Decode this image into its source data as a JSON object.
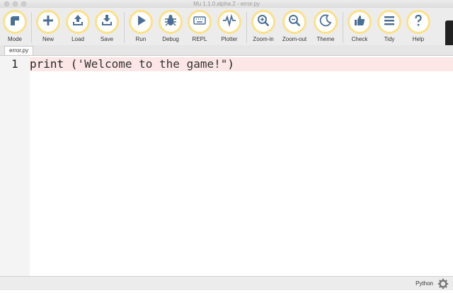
{
  "window": {
    "title": "Mu 1.1.0.alpha.2 - error.py"
  },
  "toolbar": {
    "buttons": [
      {
        "label": "Mode",
        "icon": "mode-icon"
      },
      {
        "label": "New",
        "icon": "plus-icon"
      },
      {
        "label": "Load",
        "icon": "upload-icon"
      },
      {
        "label": "Save",
        "icon": "download-icon"
      },
      {
        "label": "Run",
        "icon": "play-icon"
      },
      {
        "label": "Debug",
        "icon": "bug-icon"
      },
      {
        "label": "REPL",
        "icon": "keyboard-icon"
      },
      {
        "label": "Plotter",
        "icon": "pulse-icon"
      },
      {
        "label": "Zoom-in",
        "icon": "zoom-in-icon"
      },
      {
        "label": "Zoom-out",
        "icon": "zoom-out-icon"
      },
      {
        "label": "Theme",
        "icon": "moon-icon"
      },
      {
        "label": "Check",
        "icon": "thumbs-up-icon"
      },
      {
        "label": "Tidy",
        "icon": "lines-icon"
      },
      {
        "label": "Help",
        "icon": "question-icon"
      }
    ],
    "accent": "#fbe18a",
    "icon_color": "#4a6f96"
  },
  "tabs": [
    {
      "label": "error.py"
    }
  ],
  "editor": {
    "lines": [
      {
        "number": "1",
        "before_string": "print (",
        "string": "'Welcome to the game!\"",
        "after_string": ")"
      }
    ],
    "error_highlight": "#fde6e6"
  },
  "statusbar": {
    "mode": "Python",
    "icon": "gear-icon"
  }
}
